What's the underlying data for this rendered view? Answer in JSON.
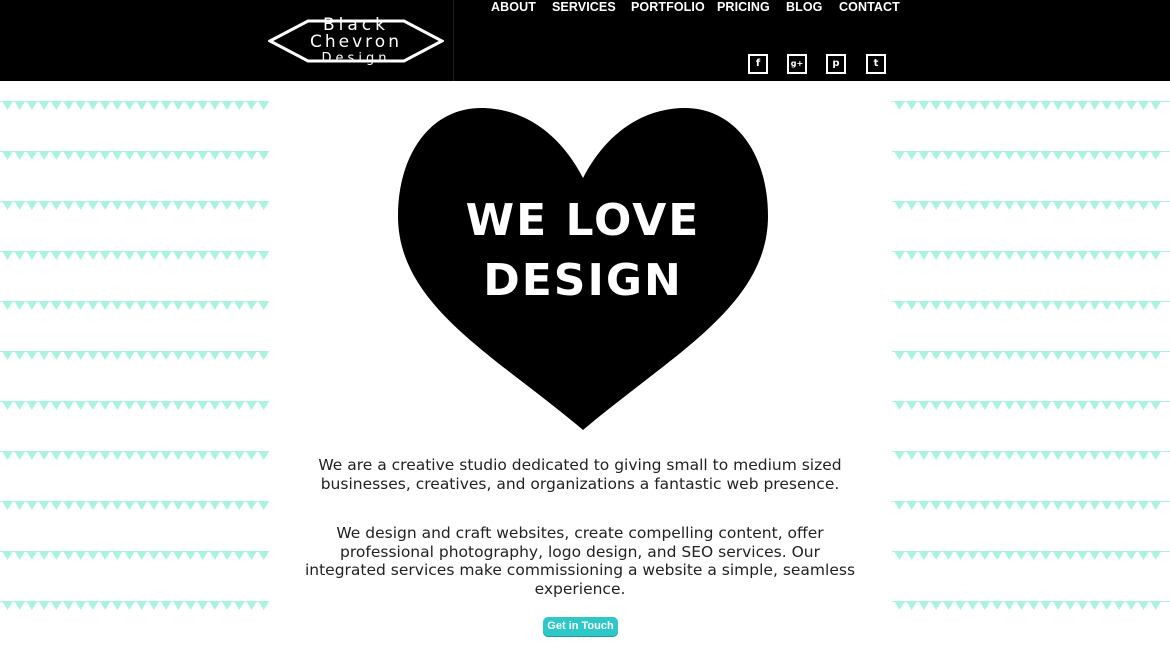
{
  "brand": {
    "logo_line1": "Black",
    "logo_line2": "Chevron",
    "logo_line3": "Design"
  },
  "nav": [
    {
      "label": "ABOUT"
    },
    {
      "label": "SERVICES"
    },
    {
      "label": "PORTFOLIO"
    },
    {
      "label": "PRICING"
    },
    {
      "label": "BLOG"
    },
    {
      "label": "CONTACT"
    }
  ],
  "social": [
    {
      "icon": "facebook-icon",
      "glyph": "f"
    },
    {
      "icon": "google-plus-icon",
      "glyph": "g+"
    },
    {
      "icon": "pinterest-icon",
      "glyph": "p"
    },
    {
      "icon": "twitter-icon",
      "glyph": "t"
    }
  ],
  "hero": {
    "title_line1": "WE LOVE",
    "title_line2": "DESIGN",
    "paragraph1": "We are a creative studio dedicated to giving small to medium sized businesses, creatives, and organizations a fantastic web presence.",
    "paragraph2": "We design and craft websites, create compelling content, offer professional photography, logo design, and SEO services. Our integrated services make commissioning a website a simple, seamless experience.",
    "cta_label": "Get in Touch"
  },
  "colors": {
    "header_bg": "#000000",
    "bunting": "#a9f3e0",
    "cta": "#2ec8c8",
    "heart": "#000000"
  }
}
